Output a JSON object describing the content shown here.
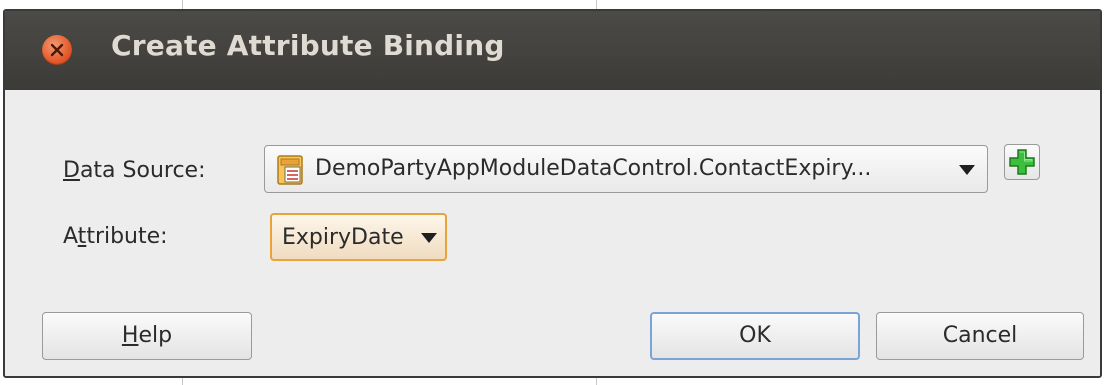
{
  "dialog": {
    "title": "Create Attribute Binding",
    "close_icon": "close-icon"
  },
  "form": {
    "data_source": {
      "label_mnemonic": "D",
      "label_rest": "ata Source:",
      "value": "DemoPartyAppModuleDataControl.ContactExpiry...",
      "icon": "data-control-icon",
      "dropdown_icon": "chevron-down-icon"
    },
    "add_button": {
      "icon": "green-plus-icon",
      "color": "#2fa82f"
    },
    "attribute": {
      "label_pre": "A",
      "label_mnemonic": "t",
      "label_rest": "tribute:",
      "value": "ExpiryDate",
      "dropdown_icon": "chevron-down-icon",
      "focus_color": "#e8a33a"
    }
  },
  "buttons": {
    "help_mnemonic": "H",
    "help_rest": "elp",
    "ok": "OK",
    "cancel": "Cancel",
    "default_border_color": "#7aa4d6"
  },
  "colors": {
    "titlebar": "#3c3b37",
    "title_text": "#dfdbd2",
    "close_button": "#e45a2a",
    "dialog_body": "#ededed"
  }
}
